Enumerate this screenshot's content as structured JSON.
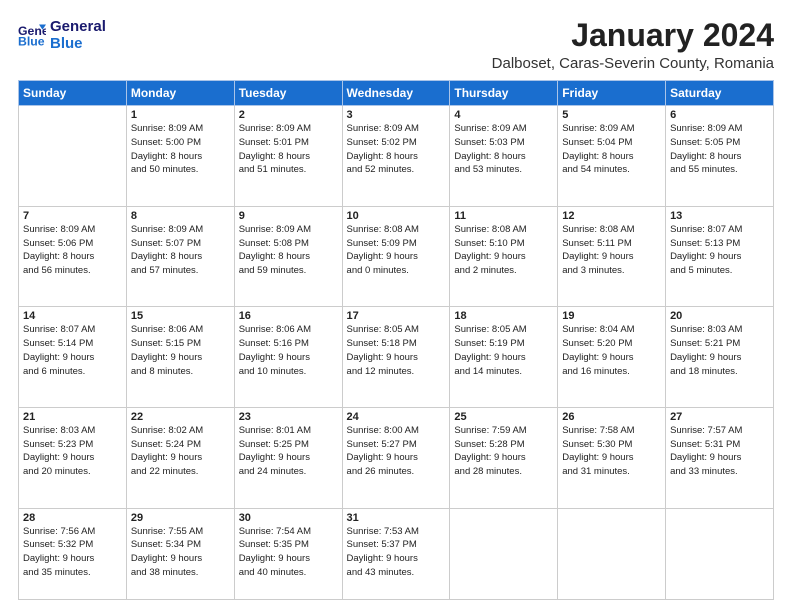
{
  "logo": {
    "line1": "General",
    "line2": "Blue"
  },
  "title": "January 2024",
  "subtitle": "Dalboset, Caras-Severin County, Romania",
  "days_header": [
    "Sunday",
    "Monday",
    "Tuesday",
    "Wednesday",
    "Thursday",
    "Friday",
    "Saturday"
  ],
  "weeks": [
    [
      {
        "num": "",
        "info": ""
      },
      {
        "num": "1",
        "info": "Sunrise: 8:09 AM\nSunset: 5:00 PM\nDaylight: 8 hours\nand 50 minutes."
      },
      {
        "num": "2",
        "info": "Sunrise: 8:09 AM\nSunset: 5:01 PM\nDaylight: 8 hours\nand 51 minutes."
      },
      {
        "num": "3",
        "info": "Sunrise: 8:09 AM\nSunset: 5:02 PM\nDaylight: 8 hours\nand 52 minutes."
      },
      {
        "num": "4",
        "info": "Sunrise: 8:09 AM\nSunset: 5:03 PM\nDaylight: 8 hours\nand 53 minutes."
      },
      {
        "num": "5",
        "info": "Sunrise: 8:09 AM\nSunset: 5:04 PM\nDaylight: 8 hours\nand 54 minutes."
      },
      {
        "num": "6",
        "info": "Sunrise: 8:09 AM\nSunset: 5:05 PM\nDaylight: 8 hours\nand 55 minutes."
      }
    ],
    [
      {
        "num": "7",
        "info": "Sunrise: 8:09 AM\nSunset: 5:06 PM\nDaylight: 8 hours\nand 56 minutes."
      },
      {
        "num": "8",
        "info": "Sunrise: 8:09 AM\nSunset: 5:07 PM\nDaylight: 8 hours\nand 57 minutes."
      },
      {
        "num": "9",
        "info": "Sunrise: 8:09 AM\nSunset: 5:08 PM\nDaylight: 8 hours\nand 59 minutes."
      },
      {
        "num": "10",
        "info": "Sunrise: 8:08 AM\nSunset: 5:09 PM\nDaylight: 9 hours\nand 0 minutes."
      },
      {
        "num": "11",
        "info": "Sunrise: 8:08 AM\nSunset: 5:10 PM\nDaylight: 9 hours\nand 2 minutes."
      },
      {
        "num": "12",
        "info": "Sunrise: 8:08 AM\nSunset: 5:11 PM\nDaylight: 9 hours\nand 3 minutes."
      },
      {
        "num": "13",
        "info": "Sunrise: 8:07 AM\nSunset: 5:13 PM\nDaylight: 9 hours\nand 5 minutes."
      }
    ],
    [
      {
        "num": "14",
        "info": "Sunrise: 8:07 AM\nSunset: 5:14 PM\nDaylight: 9 hours\nand 6 minutes."
      },
      {
        "num": "15",
        "info": "Sunrise: 8:06 AM\nSunset: 5:15 PM\nDaylight: 9 hours\nand 8 minutes."
      },
      {
        "num": "16",
        "info": "Sunrise: 8:06 AM\nSunset: 5:16 PM\nDaylight: 9 hours\nand 10 minutes."
      },
      {
        "num": "17",
        "info": "Sunrise: 8:05 AM\nSunset: 5:18 PM\nDaylight: 9 hours\nand 12 minutes."
      },
      {
        "num": "18",
        "info": "Sunrise: 8:05 AM\nSunset: 5:19 PM\nDaylight: 9 hours\nand 14 minutes."
      },
      {
        "num": "19",
        "info": "Sunrise: 8:04 AM\nSunset: 5:20 PM\nDaylight: 9 hours\nand 16 minutes."
      },
      {
        "num": "20",
        "info": "Sunrise: 8:03 AM\nSunset: 5:21 PM\nDaylight: 9 hours\nand 18 minutes."
      }
    ],
    [
      {
        "num": "21",
        "info": "Sunrise: 8:03 AM\nSunset: 5:23 PM\nDaylight: 9 hours\nand 20 minutes."
      },
      {
        "num": "22",
        "info": "Sunrise: 8:02 AM\nSunset: 5:24 PM\nDaylight: 9 hours\nand 22 minutes."
      },
      {
        "num": "23",
        "info": "Sunrise: 8:01 AM\nSunset: 5:25 PM\nDaylight: 9 hours\nand 24 minutes."
      },
      {
        "num": "24",
        "info": "Sunrise: 8:00 AM\nSunset: 5:27 PM\nDaylight: 9 hours\nand 26 minutes."
      },
      {
        "num": "25",
        "info": "Sunrise: 7:59 AM\nSunset: 5:28 PM\nDaylight: 9 hours\nand 28 minutes."
      },
      {
        "num": "26",
        "info": "Sunrise: 7:58 AM\nSunset: 5:30 PM\nDaylight: 9 hours\nand 31 minutes."
      },
      {
        "num": "27",
        "info": "Sunrise: 7:57 AM\nSunset: 5:31 PM\nDaylight: 9 hours\nand 33 minutes."
      }
    ],
    [
      {
        "num": "28",
        "info": "Sunrise: 7:56 AM\nSunset: 5:32 PM\nDaylight: 9 hours\nand 35 minutes."
      },
      {
        "num": "29",
        "info": "Sunrise: 7:55 AM\nSunset: 5:34 PM\nDaylight: 9 hours\nand 38 minutes."
      },
      {
        "num": "30",
        "info": "Sunrise: 7:54 AM\nSunset: 5:35 PM\nDaylight: 9 hours\nand 40 minutes."
      },
      {
        "num": "31",
        "info": "Sunrise: 7:53 AM\nSunset: 5:37 PM\nDaylight: 9 hours\nand 43 minutes."
      },
      {
        "num": "",
        "info": ""
      },
      {
        "num": "",
        "info": ""
      },
      {
        "num": "",
        "info": ""
      }
    ]
  ]
}
